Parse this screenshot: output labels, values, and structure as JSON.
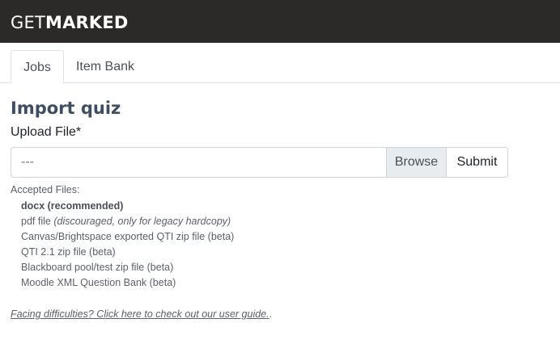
{
  "header": {
    "logo_light": "GET",
    "logo_bold": "MARKED",
    "background": "#2b2a28"
  },
  "tabs": [
    {
      "label": "Jobs",
      "active": true
    },
    {
      "label": "Item Bank",
      "active": false
    }
  ],
  "main": {
    "title": "Import quiz",
    "upload_label": "Upload File*",
    "file_input": {
      "value": "",
      "placeholder": "---"
    },
    "browse_label": "Browse",
    "submit_label": "Submit",
    "accepted": {
      "title": "Accepted Files:",
      "items": [
        {
          "text": "docx (recommended)",
          "note": ""
        },
        {
          "text": "pdf file",
          "note": "(discouraged, only for legacy hardcopy)"
        },
        {
          "text": "Canvas/Brightspace exported QTI zip file (beta)",
          "note": ""
        },
        {
          "text": "QTI 2.1 zip file (beta)",
          "note": ""
        },
        {
          "text": "Blackboard pool/test zip file (beta)",
          "note": ""
        },
        {
          "text": "Moodle XML Question Bank (beta)",
          "note": ""
        }
      ]
    },
    "guide_link": "Facing difficulties? Click here to check out our user guide.",
    "guide_suffix": "."
  },
  "colors": {
    "title": "#3d4e63",
    "browse_bg": "#e9ecef",
    "border": "#ced4da"
  }
}
